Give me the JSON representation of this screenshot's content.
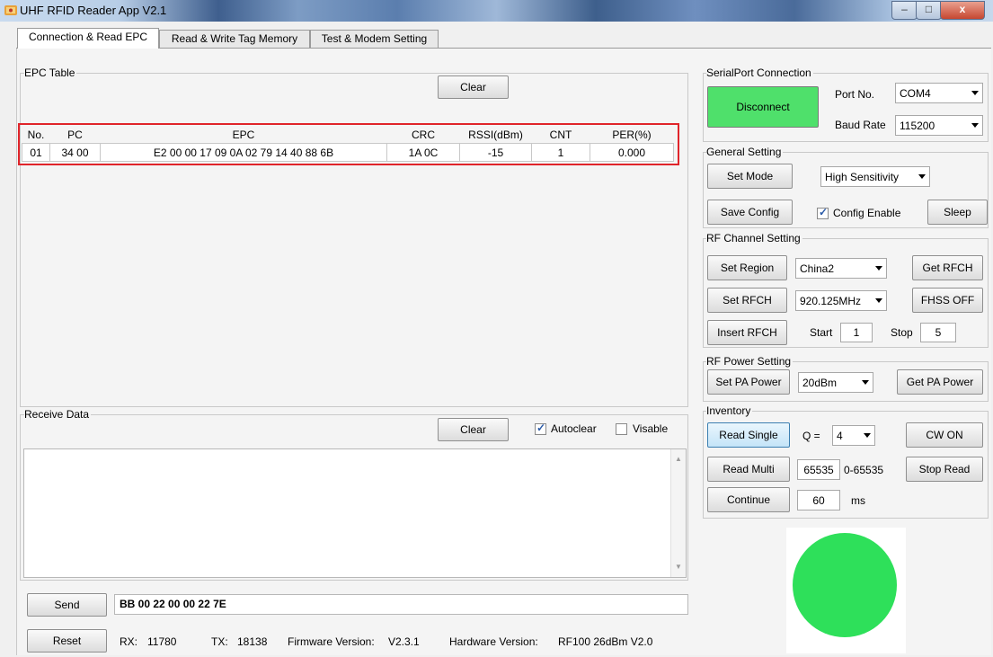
{
  "window": {
    "title": "UHF RFID Reader App V2.1",
    "minimize": "–",
    "maximize": "□",
    "close": "x"
  },
  "tabs": [
    "Connection & Read EPC",
    "Read & Write Tag Memory",
    "Test & Modem Setting"
  ],
  "epc_table": {
    "label": "EPC Table",
    "clear_label": "Clear",
    "columns": [
      "No.",
      "PC",
      "EPC",
      "CRC",
      "RSSI(dBm)",
      "CNT",
      "PER(%)"
    ],
    "rows": [
      [
        "01",
        "34 00",
        "E2 00 00 17 09 0A 02 79 14 40 88 6B",
        "1A 0C",
        "-15",
        "1",
        "0.000"
      ]
    ]
  },
  "receive_data": {
    "label": "Receive Data",
    "clear_label": "Clear",
    "autoclear_label": "Autoclear",
    "autoclear_checked": true,
    "visable_label": "Visable",
    "visable_checked": false
  },
  "send": {
    "button_label": "Send",
    "value": "BB 00 22 00 00 22 7E"
  },
  "status": {
    "reset_label": "Reset",
    "rx_label": "RX:",
    "rx_value": "11780",
    "tx_label": "TX:",
    "tx_value": "18138",
    "firmware_label": "Firmware Version:",
    "firmware_value": "V2.3.1",
    "hardware_label": "Hardware Version:",
    "hardware_value": "RF100 26dBm V2.0"
  },
  "serial": {
    "label": "SerialPort Connection",
    "disconnect_label": "Disconnect",
    "port_label": "Port No.",
    "port_value": "COM4",
    "baud_label": "Baud Rate",
    "baud_value": "115200"
  },
  "general": {
    "label": "General Setting",
    "set_mode_label": "Set Mode",
    "mode_value": "High Sensitivity",
    "save_config_label": "Save Config",
    "config_enable_label": "Config Enable",
    "config_enable_checked": true,
    "sleep_label": "Sleep"
  },
  "rf_channel": {
    "label": "RF Channel Setting",
    "set_region_label": "Set Region",
    "region_value": "China2",
    "get_rfch_label": "Get RFCH",
    "set_rfch_label": "Set RFCH",
    "freq_value": "920.125MHz",
    "fhss_label": "FHSS OFF",
    "insert_rfch_label": "Insert RFCH",
    "start_label": "Start",
    "start_value": "1",
    "stop_label": "Stop",
    "stop_value": "5"
  },
  "rf_power": {
    "label": "RF Power Setting",
    "set_pa_label": "Set PA Power",
    "power_value": "20dBm",
    "get_pa_label": "Get PA Power"
  },
  "inventory": {
    "label": "Inventory",
    "read_single_label": "Read Single",
    "q_label": "Q =",
    "q_value": "4",
    "cw_on_label": "CW ON",
    "read_multi_label": "Read Multi",
    "multi_value": "65535",
    "multi_range": "0-65535",
    "stop_read_label": "Stop Read",
    "continue_label": "Continue",
    "continue_value": "60",
    "ms_label": "ms"
  },
  "colors": {
    "connected": "#4fe06b",
    "indicator": "#2ee05a",
    "highlight": "#e0242a"
  }
}
